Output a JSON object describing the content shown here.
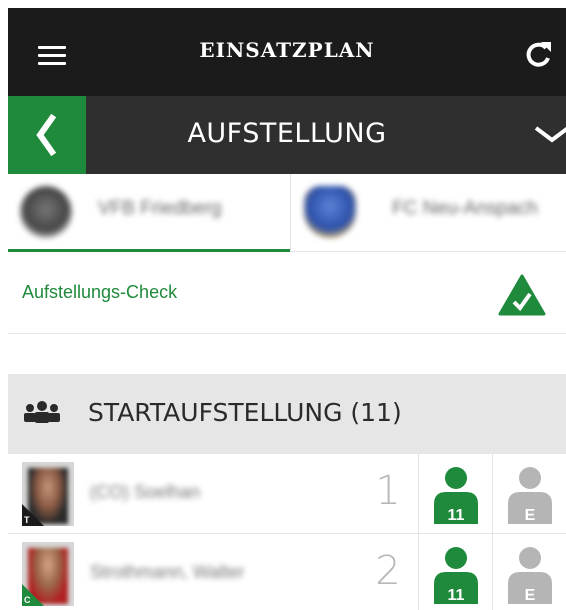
{
  "header": {
    "app_title": "EINSATZPLAN",
    "menu_icon": "hamburger-menu-icon",
    "refresh_icon": "refresh-icon"
  },
  "subheader": {
    "title": "AUFSTELLUNG",
    "back_icon": "chevron-left-icon",
    "expand_icon": "chevron-down-icon"
  },
  "teams": {
    "home": {
      "name": "VFB Friedberg"
    },
    "away": {
      "name": "FC Neu-Anspach"
    }
  },
  "check": {
    "label": "Aufstellungs-Check",
    "icon": "check-warning-icon"
  },
  "section": {
    "title": "STARTAUFSTELLUNG (11)",
    "icon": "team-group-icon"
  },
  "players": [
    {
      "name": "(CO) Soelhan",
      "number": "1",
      "corner": "T",
      "starter_badge": "11",
      "sub_badge": "E"
    },
    {
      "name": "Strothmann, Walter",
      "number": "2",
      "corner": "C",
      "starter_badge": "11",
      "sub_badge": "E"
    }
  ],
  "colors": {
    "accent": "#1f8a3c",
    "topbar": "#1b1b1b",
    "subbar": "#2f2f2f",
    "section_bg": "#e6e6e6",
    "inactive_icon": "#b5b5b5"
  }
}
